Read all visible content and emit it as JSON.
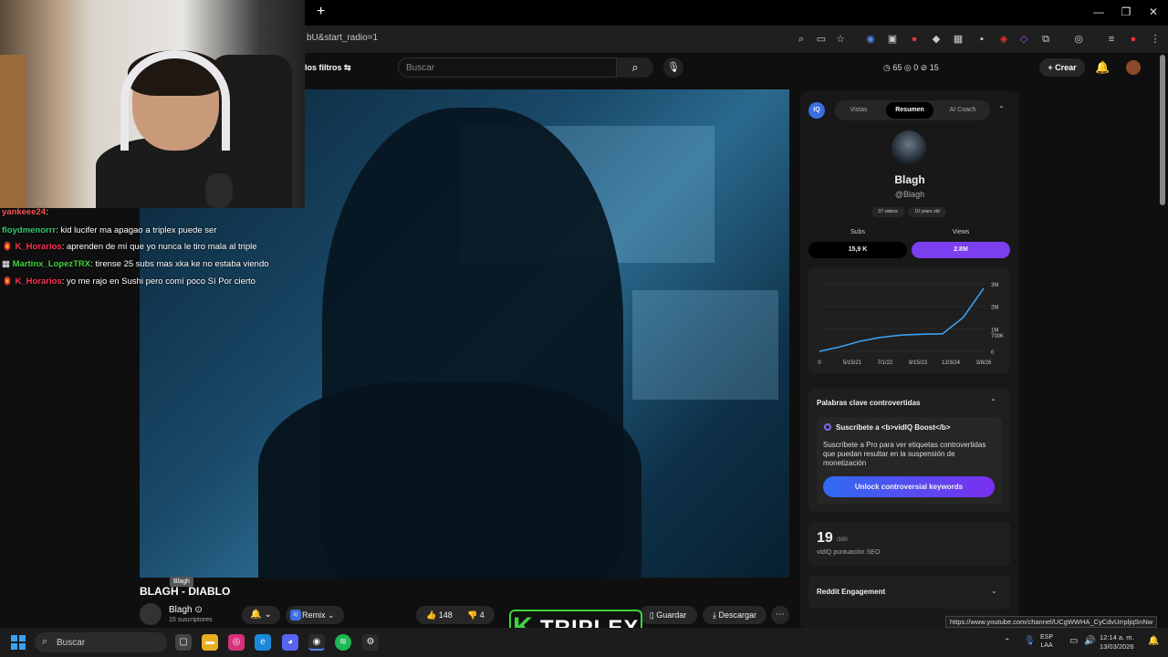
{
  "browser": {
    "url": "bU&start_radio=1",
    "new_tab": "+"
  },
  "header": {
    "filters_label": "los filtros",
    "search_placeholder": "Buscar",
    "stats": {
      "a": "65",
      "b": "0",
      "c": "15"
    },
    "create_label": "Crear"
  },
  "chat": [
    {
      "user": "yankeee24",
      "message": ":",
      "color": "#ff5555"
    },
    {
      "user": "floydmenorrr",
      "message": ": kid lucifer ma apagao a triplex puede ser",
      "color": "#2ecc71"
    },
    {
      "user": "K_Horarios",
      "message": ": aprenden de mí que yo nunca le tiro mala al triple",
      "color": "#ff3355"
    },
    {
      "user": "Martinx_LopezTRX",
      "message": ": tirense 25 subs mas xka ke no estaba viendo",
      "color": "#3ed43e"
    },
    {
      "user": "K_Horarios",
      "message": ": yo me rajo en Sushi pero comí poco Sí Por cierto",
      "color": "#ff3355"
    }
  ],
  "video": {
    "title": "BLAGH - DIABLO",
    "tooltip": "Blagh",
    "channel": "Blagh",
    "subscribers": "15 suscriptores",
    "remix_label": "Remix",
    "likes": "148",
    "dislikes": "4",
    "save_label": "Guardar",
    "download_label": "Descargar"
  },
  "vidiq": {
    "tabs": [
      "Vistas",
      "Resumen",
      "AI Coach"
    ],
    "active_tab": "Resumen",
    "channel_name": "Blagh",
    "handle": "@Blagh",
    "videos_pill": "37 videos",
    "age_pill": "10 years old",
    "subs_label": "Subs",
    "subs_value": "15,9 K",
    "views_label": "Views",
    "views_value": "2.8M",
    "kw_title": "Palabras clave controvertidas",
    "boost_title": "Suscríbete a <b>vidIQ Boost</b>",
    "boost_text": "Suscríbete a Pro para ver etiquetas controvertidas que puedan resultar en la suspensión de monetización",
    "unlock_label": "Unlock controversial keywords",
    "seo_score": "19",
    "seo_max": "/100",
    "seo_label": "vidIQ puntuación SEO",
    "reddit_label": "Reddit Engagement"
  },
  "chart_data": {
    "type": "line",
    "x_ticks": [
      "0",
      "5/15/21",
      "7/1/22",
      "8/15/23",
      "12/3/24",
      "3/8/26"
    ],
    "y_ticks": [
      "3M",
      "2M",
      "1M",
      "700K",
      "0"
    ],
    "x": [
      "2020-06",
      "2021-05",
      "2022-07",
      "2023-08",
      "2024-06",
      "2024-12",
      "2025-06",
      "2025-12",
      "2026-03"
    ],
    "values": [
      0,
      200000,
      450000,
      620000,
      720000,
      760000,
      780000,
      1500000,
      2800000
    ],
    "ylim": [
      0,
      3000000
    ]
  },
  "status_url": "https://www.youtube.com/channel/UCgWWHA_CyCdvUrrpljqSnNw",
  "taskbar": {
    "search_label": "Buscar",
    "lang": "ESP",
    "lang2": "LAA",
    "time": "12:14 a. m.",
    "date": "13/03/2026"
  },
  "overlay": {
    "logo_k": "K",
    "logo_text": "TRIPLEX"
  }
}
